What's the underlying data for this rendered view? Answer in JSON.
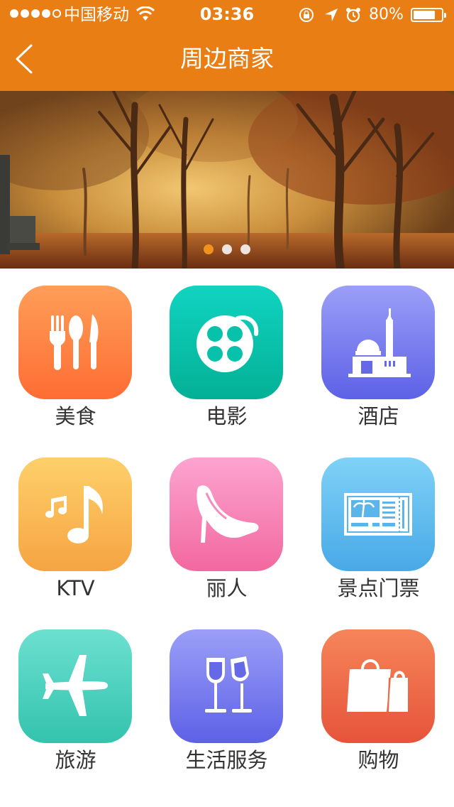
{
  "status_bar": {
    "carrier": "中国移动",
    "time": "03:36",
    "battery": "80%",
    "battery_level": 0.8,
    "signal_bars": 4,
    "icons": [
      "signal-dots-icon",
      "wifi-icon",
      "rotation-lock-icon",
      "location-arrow-icon",
      "alarm-clock-icon",
      "battery-icon"
    ]
  },
  "nav": {
    "title": "周边商家",
    "back_icon": "chevron-left-icon"
  },
  "banner": {
    "total_pages": 3,
    "active_page": 1
  },
  "colors": {
    "header": "#e87e14",
    "label_text": "#333333",
    "active_dot": "#f2911e"
  },
  "categories": [
    {
      "label": "美食",
      "icon": "fork-spoon-knife-icon",
      "gradient": [
        "#fe9e58",
        "#fe6d33"
      ]
    },
    {
      "label": "电影",
      "icon": "film-reel-icon",
      "gradient": [
        "#10d4c0",
        "#03b096"
      ]
    },
    {
      "label": "酒店",
      "icon": "hotel-building-icon",
      "gradient": [
        "#9b9ff7",
        "#5d61e6"
      ]
    },
    {
      "label": "KTV",
      "icon": "music-note-icon",
      "gradient": [
        "#fdd06a",
        "#f6a442"
      ]
    },
    {
      "label": "丽人",
      "icon": "high-heel-icon",
      "gradient": [
        "#fca4d0",
        "#f2689f"
      ]
    },
    {
      "label": "景点门票",
      "icon": "ticket-icon",
      "gradient": [
        "#7fd2f7",
        "#48a9e7"
      ]
    },
    {
      "label": "旅游",
      "icon": "airplane-icon",
      "gradient": [
        "#6ce0d1",
        "#33c3ad"
      ]
    },
    {
      "label": "生活服务",
      "icon": "wine-glasses-icon",
      "gradient": [
        "#9b9ff7",
        "#5d61e6"
      ]
    },
    {
      "label": "购物",
      "icon": "shopping-bag-icon",
      "gradient": [
        "#f6855a",
        "#e6543a"
      ]
    }
  ]
}
